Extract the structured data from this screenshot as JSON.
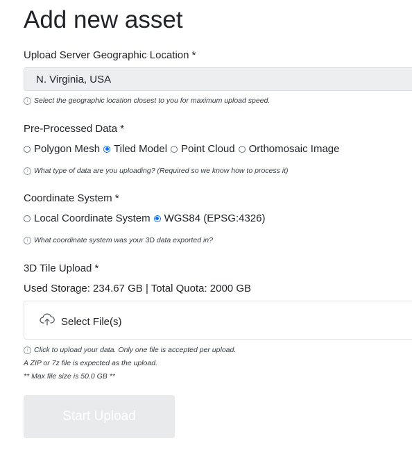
{
  "page": {
    "title": "Add new asset"
  },
  "location": {
    "label": "Upload Server Geographic Location *",
    "value": "N. Virginia, USA",
    "hint": "Select the geographic location closest to you for maximum upload speed."
  },
  "data_type": {
    "label": "Pre-Processed Data *",
    "options": [
      "Polygon Mesh",
      "Tiled Model",
      "Point Cloud",
      "Orthomosaic Image"
    ],
    "selected": "Tiled Model",
    "hint": "What type of data are you uploading? (Required so we know how to process it)"
  },
  "coord_system": {
    "label": "Coordinate System *",
    "options": [
      "Local Coordinate System",
      "WGS84 (EPSG:4326)"
    ],
    "selected": "WGS84 (EPSG:4326)",
    "hint": "What coordinate system was your 3D data exported in?"
  },
  "upload": {
    "label": "3D Tile Upload *",
    "storage": "Used Storage: 234.67 GB | Total Quota: 2000 GB",
    "select_label": "Select File(s)",
    "hint": "Click to upload your data. Only one file is accepted per upload.",
    "format_note": "A ZIP or 7z file is expected as the upload.",
    "max_size_note": "** Max file size is 50.0 GB **"
  },
  "actions": {
    "start_label": "Start Upload"
  },
  "colors": {
    "accent": "#0d6efd",
    "disabled_button": "#e9eaec"
  }
}
